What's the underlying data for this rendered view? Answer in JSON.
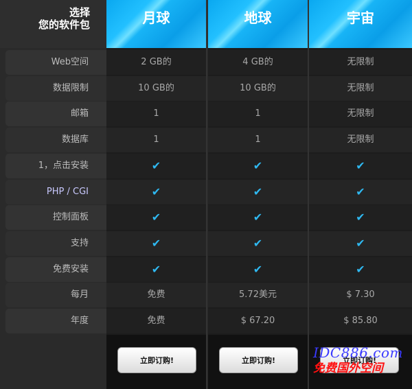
{
  "title": {
    "line1": "选择",
    "line2": "您的软件包"
  },
  "plans": [
    {
      "name": "月球",
      "button": "立即订购!"
    },
    {
      "name": "地球",
      "button": "立即订购!"
    },
    {
      "name": "宇宙",
      "button": "立即订购!"
    }
  ],
  "rows": [
    {
      "label": "Web空间",
      "values": [
        "2 GB的",
        "4 GB的",
        "无限制"
      ]
    },
    {
      "label": "数据限制",
      "values": [
        "10 GB的",
        "10 GB的",
        "无限制"
      ]
    },
    {
      "label": "邮箱",
      "values": [
        "1",
        "1",
        "无限制"
      ]
    },
    {
      "label": "数据库",
      "values": [
        "1",
        "1",
        "无限制"
      ]
    },
    {
      "label": "1，点击安装",
      "values": [
        "✔",
        "✔",
        "✔"
      ]
    },
    {
      "label": "PHP / CGI",
      "values": [
        "✔",
        "✔",
        "✔"
      ]
    },
    {
      "label": "控制面板",
      "values": [
        "✔",
        "✔",
        "✔"
      ]
    },
    {
      "label": "支持",
      "values": [
        "✔",
        "✔",
        "✔"
      ]
    },
    {
      "label": "免费安装",
      "values": [
        "✔",
        "✔",
        "✔"
      ]
    },
    {
      "label": "每月",
      "values": [
        "免费",
        "5.72美元",
        "$ 7.30"
      ]
    },
    {
      "label": "年度",
      "values": [
        "免费",
        "$ 67.20",
        "$ 85.80"
      ]
    }
  ],
  "check_icon": "check-icon",
  "colors": {
    "accent": "#18b4f6",
    "check": "#2fb8f0"
  },
  "watermark": {
    "line1": "IDC886.com",
    "line2": "免费国外空间"
  }
}
